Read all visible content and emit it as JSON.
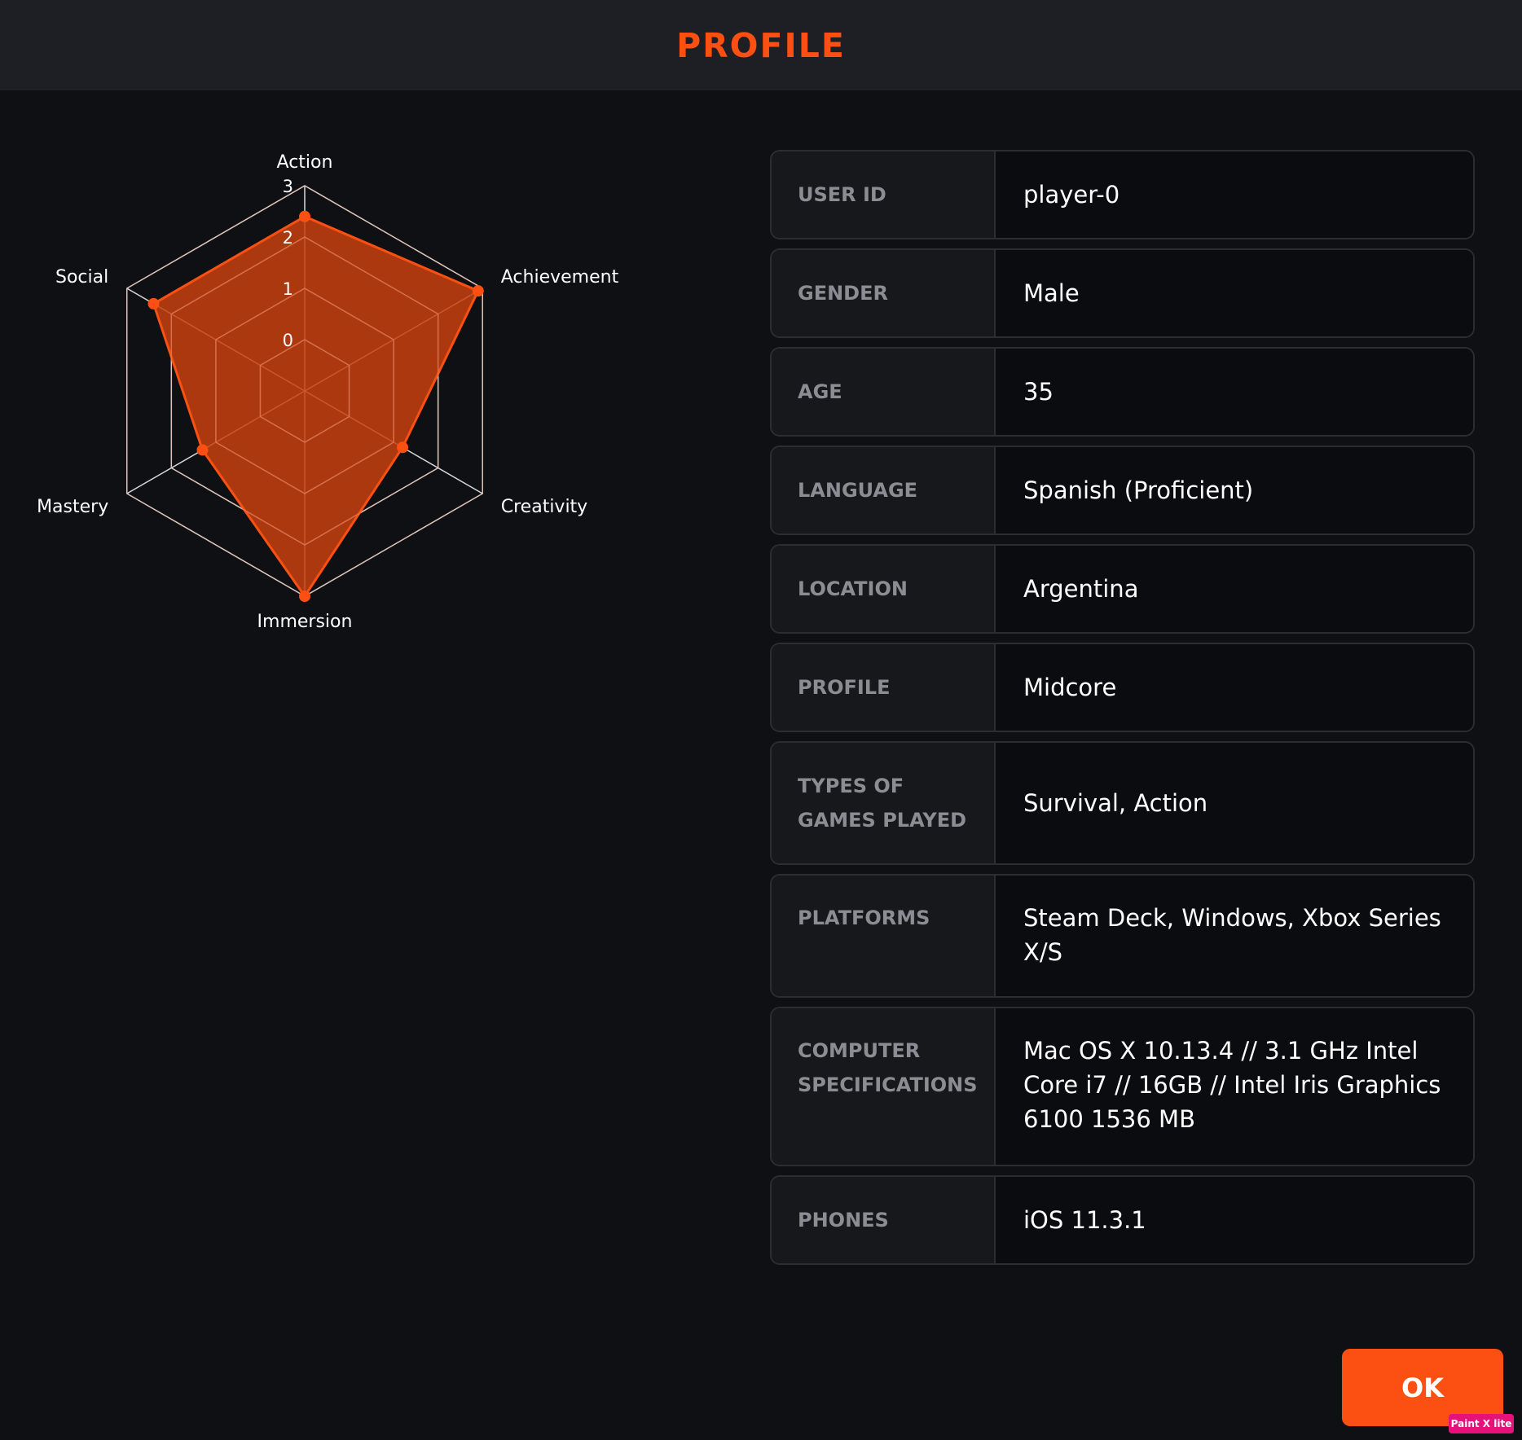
{
  "header": {
    "title": "PROFILE"
  },
  "chart_data": {
    "type": "radar",
    "axes": [
      "Action",
      "Achievement",
      "Creativity",
      "Immersion",
      "Mastery",
      "Social"
    ],
    "values": [
      2.4,
      2.9,
      1.2,
      3.0,
      1.3,
      2.4
    ],
    "ticks": [
      "0",
      "1",
      "2",
      "3"
    ],
    "range": [
      -1,
      3
    ],
    "fill_color": "#c8400f",
    "line_color": "#fb5012",
    "grid": true
  },
  "profile": {
    "rows": [
      {
        "label": "USER ID",
        "value": "player-0"
      },
      {
        "label": "GENDER",
        "value": "Male"
      },
      {
        "label": "AGE",
        "value": "35"
      },
      {
        "label": "LANGUAGE",
        "value": "Spanish (Proficient)"
      },
      {
        "label": "LOCATION",
        "value": "Argentina"
      },
      {
        "label": "PROFILE",
        "value": "Midcore"
      },
      {
        "label": "TYPES OF GAMES PLAYED",
        "value": "Survival, Action"
      },
      {
        "label": "PLATFORMS",
        "value": "Steam Deck, Windows, Xbox Series X/S"
      },
      {
        "label": "COMPUTER SPECIFICATIONS",
        "value": "Mac OS X 10.13.4 // 3.1 GHz Intel Core i7 // 16GB // Intel Iris Graphics 6100 1536 MB"
      },
      {
        "label": "PHONES",
        "value": "iOS 11.3.1"
      }
    ]
  },
  "actions": {
    "ok_label": "OK"
  },
  "watermark": "Paint X lite",
  "colors": {
    "accent": "#fb5012",
    "background": "#0f1014",
    "header": "#1e1f24"
  }
}
